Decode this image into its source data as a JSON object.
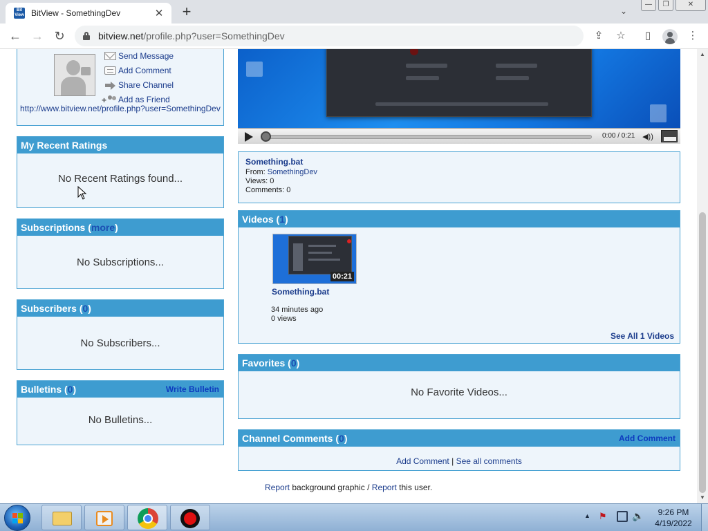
{
  "browser": {
    "tab_title": "BitView - SomethingDev",
    "favicon_text_top": "Bit",
    "favicon_text_bottom": "View",
    "url_host": "bitview.net",
    "url_path": "/profile.php?user=SomethingDev"
  },
  "profile": {
    "actions": [
      "Send Message",
      "Add Comment",
      "Share Channel",
      "Add as Friend"
    ],
    "url": "http://www.bitview.net/profile.php?user=SomethingDev"
  },
  "ratings": {
    "title": "My Recent Ratings",
    "empty": "No Recent Ratings found..."
  },
  "subscriptions": {
    "title": "Subscriptions (",
    "more": "more",
    "close": ")",
    "empty": "No Subscriptions..."
  },
  "subscribers": {
    "title": "Subscribers (",
    "count": "0",
    "close": ")",
    "empty": "No Subscribers..."
  },
  "bulletins": {
    "title": "Bulletins (",
    "count": "0",
    "close": ")",
    "action": "Write Bulletin",
    "empty": "No Bulletins..."
  },
  "player": {
    "time": "0:00 / 0:21",
    "progress": 0.0
  },
  "video_info": {
    "title": "Something.bat",
    "from_label": "From: ",
    "from_user": "SomethingDev",
    "views": "Views: 0",
    "comments": "Comments: 0"
  },
  "videos": {
    "title": "Videos (",
    "count": "1",
    "close": ")",
    "item": {
      "title": "Something.bat",
      "duration": "00:21",
      "age": "34 minutes ago",
      "views": "0 views"
    },
    "see_all": "See All 1 Videos"
  },
  "favorites": {
    "title": "Favorites (",
    "count": "0",
    "close": ")",
    "empty": "No Favorite Videos..."
  },
  "channel_comments": {
    "title": "Channel Comments (",
    "count": "0",
    "close": ")",
    "action": "Add Comment",
    "add_link": "Add Comment",
    "separator": " | ",
    "see_all": "See all comments"
  },
  "footer": {
    "report1": "Report",
    "text1": " background graphic / ",
    "report2": "Report",
    "text2": " this user."
  },
  "taskbar": {
    "time": "9:26 PM",
    "date": "4/19/2022"
  }
}
